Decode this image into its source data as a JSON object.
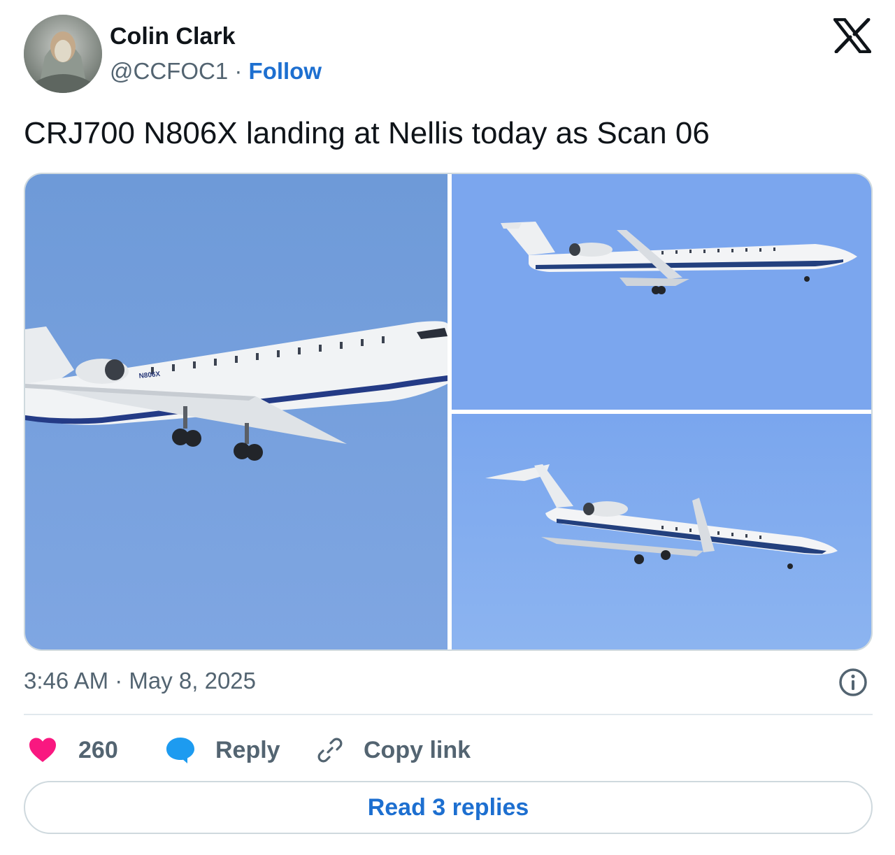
{
  "author": {
    "name": "Colin Clark",
    "handle": "@CCFOC1",
    "separator": "·",
    "follow_label": "Follow"
  },
  "tweet": {
    "text": "CRJ700 N806X landing at Nellis today as Scan 06",
    "photos": [
      {
        "subject": "aircraft-closeup"
      },
      {
        "subject": "aircraft-side-view"
      },
      {
        "subject": "aircraft-landing-approach"
      }
    ],
    "registration_marking": "N806X",
    "timestamp": "3:46 AM · May 8, 2025"
  },
  "actions": {
    "like_count": "260",
    "reply_label": "Reply",
    "copy_label": "Copy link"
  },
  "read_replies_label": "Read 3 replies",
  "colors": {
    "accent": "#1d6fd0",
    "like": "#f91880",
    "reply_bubble": "#1d9bf0",
    "secondary_text": "#536471",
    "sky": "#7aa3e0"
  },
  "icons": {
    "brand": "x-logo-icon",
    "info": "info-icon",
    "like": "heart-icon",
    "reply": "chat-bubble-icon",
    "copy": "link-icon"
  }
}
